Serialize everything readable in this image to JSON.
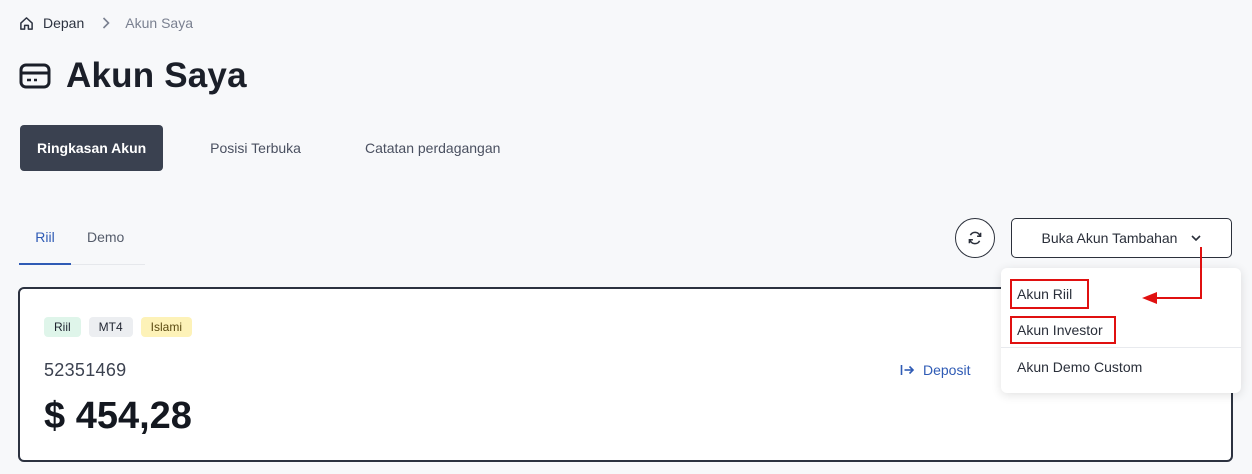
{
  "breadcrumb": {
    "home": "Depan",
    "current": "Akun Saya"
  },
  "page": {
    "title": "Akun Saya"
  },
  "tabs": [
    {
      "label": "Ringkasan Akun",
      "active": true
    },
    {
      "label": "Posisi Terbuka",
      "active": false
    },
    {
      "label": "Catatan perdagangan",
      "active": false
    }
  ],
  "subtabs": [
    {
      "label": "Riil",
      "active": true
    },
    {
      "label": "Demo",
      "active": false
    }
  ],
  "toolbar": {
    "open_account_label": "Buka Akun Tambahan"
  },
  "dropdown": {
    "items": [
      {
        "label": "Akun Riil",
        "highlighted": true
      },
      {
        "label": "Akun Investor",
        "highlighted": true
      },
      {
        "label": "Akun Demo Custom",
        "highlighted": false
      }
    ]
  },
  "account": {
    "badges": [
      "Riil",
      "MT4",
      "Islami"
    ],
    "number": "52351469",
    "balance": "$ 454,28",
    "deposit_label": "Deposit"
  },
  "colors": {
    "accent": "#2f5bb5",
    "active_tab_bg": "#3a4150",
    "highlight": "#e01010",
    "badge_riil_bg": "#dff5ea",
    "badge_mt4_bg": "#eceef1",
    "badge_islami_bg": "#fdf2b8"
  }
}
